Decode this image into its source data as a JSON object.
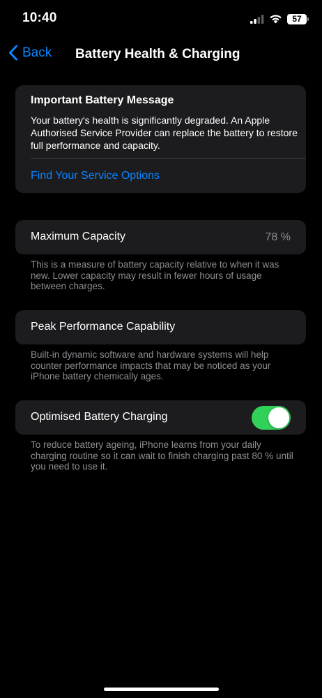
{
  "status_bar": {
    "time": "10:40",
    "battery_level": "57",
    "icons": [
      "signal-icon",
      "wifi-icon",
      "battery-icon"
    ]
  },
  "nav": {
    "back_label": "Back",
    "title": "Battery Health & Charging",
    "accent_color": "#0a84ff"
  },
  "message_card": {
    "title": "Important Battery Message",
    "body": "Your battery's health is significantly degraded. An Apple Authorised Service Provider can replace the battery to restore full performance and capacity.",
    "link_label": "Find Your Service Options"
  },
  "maximum_capacity": {
    "label": "Maximum Capacity",
    "value": "78 %",
    "note": "This is a measure of battery capacity relative to when it was new. Lower capacity may result in fewer hours of usage between charges."
  },
  "peak_performance": {
    "label": "Peak Performance Capability",
    "note": "Built-in dynamic software and hardware systems will help counter performance impacts that may be noticed as your iPhone battery chemically ages."
  },
  "optimised_charging": {
    "label": "Optimised Battery Charging",
    "enabled": true,
    "toggle_color": "#30d158",
    "note": "To reduce battery ageing, iPhone learns from your daily charging routine so it can wait to finish charging past 80 % until you need to use it."
  }
}
